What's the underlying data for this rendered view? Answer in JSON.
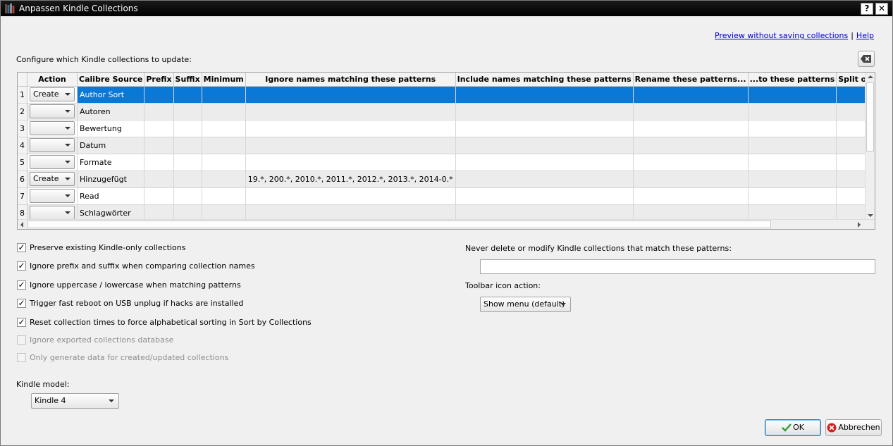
{
  "window": {
    "title": "Anpassen Kindle Collections"
  },
  "titlebar": {
    "help_glyph": "?",
    "close_glyph": "✕"
  },
  "links": {
    "preview": "Preview without saving collections",
    "separator": "|",
    "help": "Help"
  },
  "grid": {
    "label": "Configure which Kindle collections to update:",
    "columns": [
      "Action",
      "Calibre Source",
      "Prefix",
      "Suffix",
      "Minimum",
      "Ignore names matching these patterns",
      "Include names matching these patterns",
      "Rename these patterns...",
      "...to these patterns",
      "Split on charact"
    ],
    "rows": [
      {
        "num": "1",
        "action": "Create",
        "source": "Author Sort",
        "ignore": ""
      },
      {
        "num": "2",
        "action": "",
        "source": "Autoren",
        "ignore": ""
      },
      {
        "num": "3",
        "action": "",
        "source": "Bewertung",
        "ignore": ""
      },
      {
        "num": "4",
        "action": "",
        "source": "Datum",
        "ignore": ""
      },
      {
        "num": "5",
        "action": "",
        "source": "Formate",
        "ignore": ""
      },
      {
        "num": "6",
        "action": "Create",
        "source": "Hinzugefügt",
        "ignore": "19.*, 200.*, 2010.*, 2011.*, 2012.*, 2013.*, 2014-0.*"
      },
      {
        "num": "7",
        "action": "",
        "source": "Read",
        "ignore": ""
      },
      {
        "num": "8",
        "action": "",
        "source": "Schlagwörter",
        "ignore": ""
      }
    ],
    "selected_row": 0,
    "selection_color": "#0a78d7"
  },
  "options": [
    {
      "label": "Preserve existing Kindle-only collections",
      "checked": true,
      "enabled": true
    },
    {
      "label": "Ignore prefix and suffix when comparing collection names",
      "checked": true,
      "enabled": true
    },
    {
      "label": "Ignore uppercase / lowercase when matching patterns",
      "checked": true,
      "enabled": true
    },
    {
      "label": "Trigger fast reboot on USB unplug if hacks are installed",
      "checked": true,
      "enabled": true
    },
    {
      "label": "Reset collection times to force alphabetical sorting in Sort by Collections",
      "checked": true,
      "enabled": true
    },
    {
      "label": "Ignore exported collections database",
      "checked": false,
      "enabled": false
    },
    {
      "label": "Only generate data for created/updated collections",
      "checked": false,
      "enabled": false
    }
  ],
  "protect": {
    "label": "Never delete or modify Kindle collections that match these patterns:",
    "value": ""
  },
  "toolbar_action": {
    "label": "Toolbar icon action:",
    "value": "Show menu (default)"
  },
  "kindle_model": {
    "label": "Kindle model:",
    "value": "Kindle 4"
  },
  "buttons": {
    "ok": "OK",
    "cancel": "Abbrechen"
  },
  "colors": {
    "ok_icon": "#2e9e2e",
    "cancel_icon": "#d42020"
  }
}
